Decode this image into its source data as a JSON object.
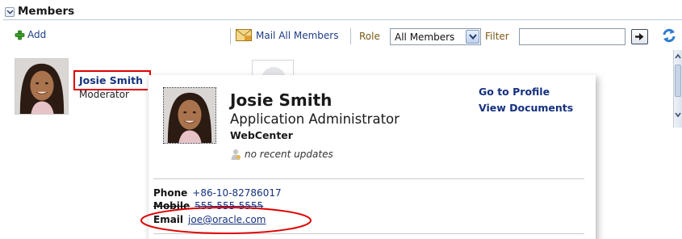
{
  "section": {
    "title": "Members"
  },
  "toolbar": {
    "add_label": "Add",
    "mail_all_label": "Mail All Members",
    "role_label": "Role",
    "role_selected": "All Members",
    "filter_label": "Filter",
    "filter_value": ""
  },
  "member": {
    "name": "Josie Smith",
    "role": "Moderator"
  },
  "card": {
    "name": "Josie Smith",
    "title": "Application Administrator",
    "organization": "WebCenter",
    "activity": "no recent updates",
    "links": {
      "profile": "Go to Profile",
      "documents": "View Documents"
    },
    "contact": {
      "phone_label": "Phone",
      "phone": "+86-10-82786017",
      "mobile_label": "Mobile",
      "mobile": "555-555-5555",
      "email_label": "Email",
      "email": "joe@oracle.com"
    }
  },
  "colors": {
    "link": "#15317e",
    "toolbar_label": "#7a5716",
    "highlight": "#e00000"
  },
  "icons": [
    "collapse-icon",
    "add-icon",
    "mail-icon",
    "dropdown-icon",
    "go-arrow-icon",
    "refresh-icon",
    "activity-icon"
  ]
}
